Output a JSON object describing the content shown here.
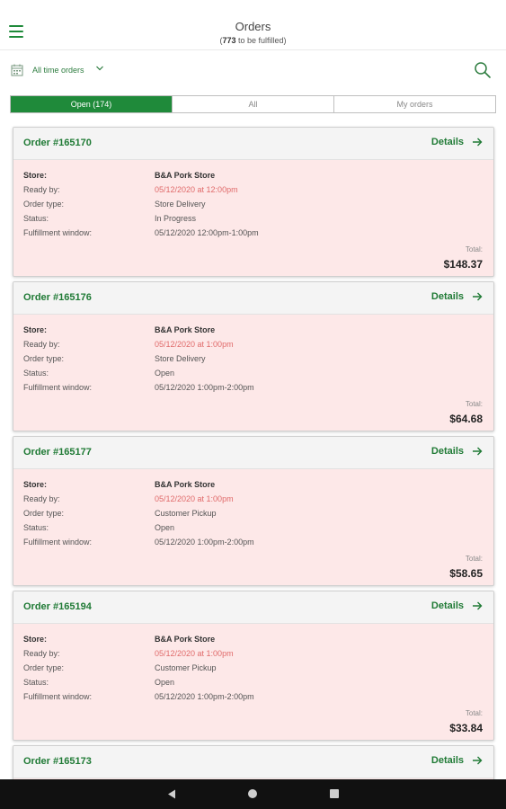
{
  "header": {
    "title": "Orders",
    "subtitle_count": "773",
    "subtitle_suffix": " to be fulfilled)",
    "subtitle_prefix": "("
  },
  "filter": {
    "label": "All time orders"
  },
  "tabs": [
    {
      "label": "Open (174)",
      "active": true
    },
    {
      "label": "All",
      "active": false
    },
    {
      "label": "My orders",
      "active": false
    }
  ],
  "labels": {
    "store": "Store:",
    "ready_by": "Ready by:",
    "order_type": "Order type:",
    "status": "Status:",
    "fulfillment_window": "Fulfillment window:",
    "total": "Total:",
    "details": "Details"
  },
  "orders": [
    {
      "id": "Order #165170",
      "store": "B&A Pork Store",
      "ready_by": "05/12/2020 at 12:00pm",
      "order_type": "Store Delivery",
      "status": "In Progress",
      "fulfillment_window": "05/12/2020 12:00pm-1:00pm",
      "total": "$148.37"
    },
    {
      "id": "Order #165176",
      "store": "B&A Pork Store",
      "ready_by": "05/12/2020 at 1:00pm",
      "order_type": "Store Delivery",
      "status": "Open",
      "fulfillment_window": "05/12/2020 1:00pm-2:00pm",
      "total": "$64.68"
    },
    {
      "id": "Order #165177",
      "store": "B&A Pork Store",
      "ready_by": "05/12/2020 at 1:00pm",
      "order_type": "Customer Pickup",
      "status": "Open",
      "fulfillment_window": "05/12/2020 1:00pm-2:00pm",
      "total": "$58.65"
    },
    {
      "id": "Order #165194",
      "store": "B&A Pork Store",
      "ready_by": "05/12/2020 at 1:00pm",
      "order_type": "Customer Pickup",
      "status": "Open",
      "fulfillment_window": "05/12/2020 1:00pm-2:00pm",
      "total": "$33.84"
    },
    {
      "id": "Order #165173"
    }
  ],
  "colors": {
    "accent": "#1f8a3a",
    "card_bg": "#fde8e8",
    "ready_by_text": "#e06a6a"
  },
  "icons": {
    "menu": "menu-icon",
    "calendar": "calendar-icon",
    "chevron": "chevron-down-icon",
    "search": "search-icon",
    "arrow": "arrow-right-icon"
  }
}
